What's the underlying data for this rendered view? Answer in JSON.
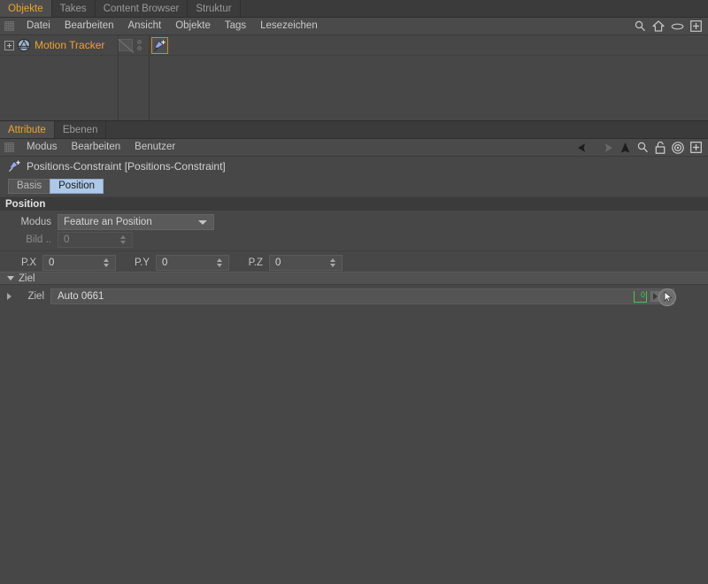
{
  "object_manager": {
    "tabs": [
      {
        "label": "Objekte",
        "active": true
      },
      {
        "label": "Takes",
        "active": false
      },
      {
        "label": "Content Browser",
        "active": false
      },
      {
        "label": "Struktur",
        "active": false
      }
    ],
    "menu": [
      "Datei",
      "Bearbeiten",
      "Ansicht",
      "Objekte",
      "Tags",
      "Lesezeichen"
    ],
    "toolbar_icons": [
      "search-icon",
      "home-icon",
      "eye-icon",
      "plus-box-icon"
    ],
    "tree": [
      {
        "label": "Motion Tracker",
        "icon": "motion-tracker-icon",
        "expandable": true,
        "tag": "position-constraint-tag-icon",
        "tag_selected": true
      }
    ]
  },
  "attribute_manager": {
    "tabs": [
      {
        "label": "Attribute",
        "active": true
      },
      {
        "label": "Ebenen",
        "active": false
      }
    ],
    "menu": [
      "Modus",
      "Bearbeiten",
      "Benutzer"
    ],
    "toolbar_icons": [
      "back-arrow-icon",
      "forward-arrow-icon",
      "up-arrow-icon",
      "search-icon",
      "lock-icon",
      "target-icon",
      "plus-box-icon"
    ],
    "object_title": "Positions-Constraint [Positions-Constraint]",
    "object_icon": "position-constraint-tag-icon",
    "tab_buttons": [
      {
        "label": "Basis",
        "selected": false
      },
      {
        "label": "Position",
        "selected": true
      }
    ],
    "sections": {
      "position": {
        "header": "Position",
        "modus_label": "Modus",
        "modus_value": "Feature an Position",
        "bild_label": "Bild ..",
        "bild_value": "0",
        "bild_disabled": true,
        "coords": [
          {
            "label": "P.X",
            "value": "0"
          },
          {
            "label": "P.Y",
            "value": "0"
          },
          {
            "label": "P.Z",
            "value": "0"
          }
        ]
      },
      "ziel": {
        "header": "Ziel",
        "row_label": "Ziel",
        "value": "Auto 0661",
        "layer_badge": "0",
        "expand_icon": "chevron-right-icon",
        "dropdown_icon": "chevron-right-icon",
        "pick_icon": "cursor-pick-icon"
      }
    }
  },
  "colors": {
    "accent_orange": "#f0a22e",
    "selection_blue": "#adc8e8",
    "badge_green": "#4fc24f",
    "background": "#474747",
    "panel_dark": "#3b3b3b"
  }
}
